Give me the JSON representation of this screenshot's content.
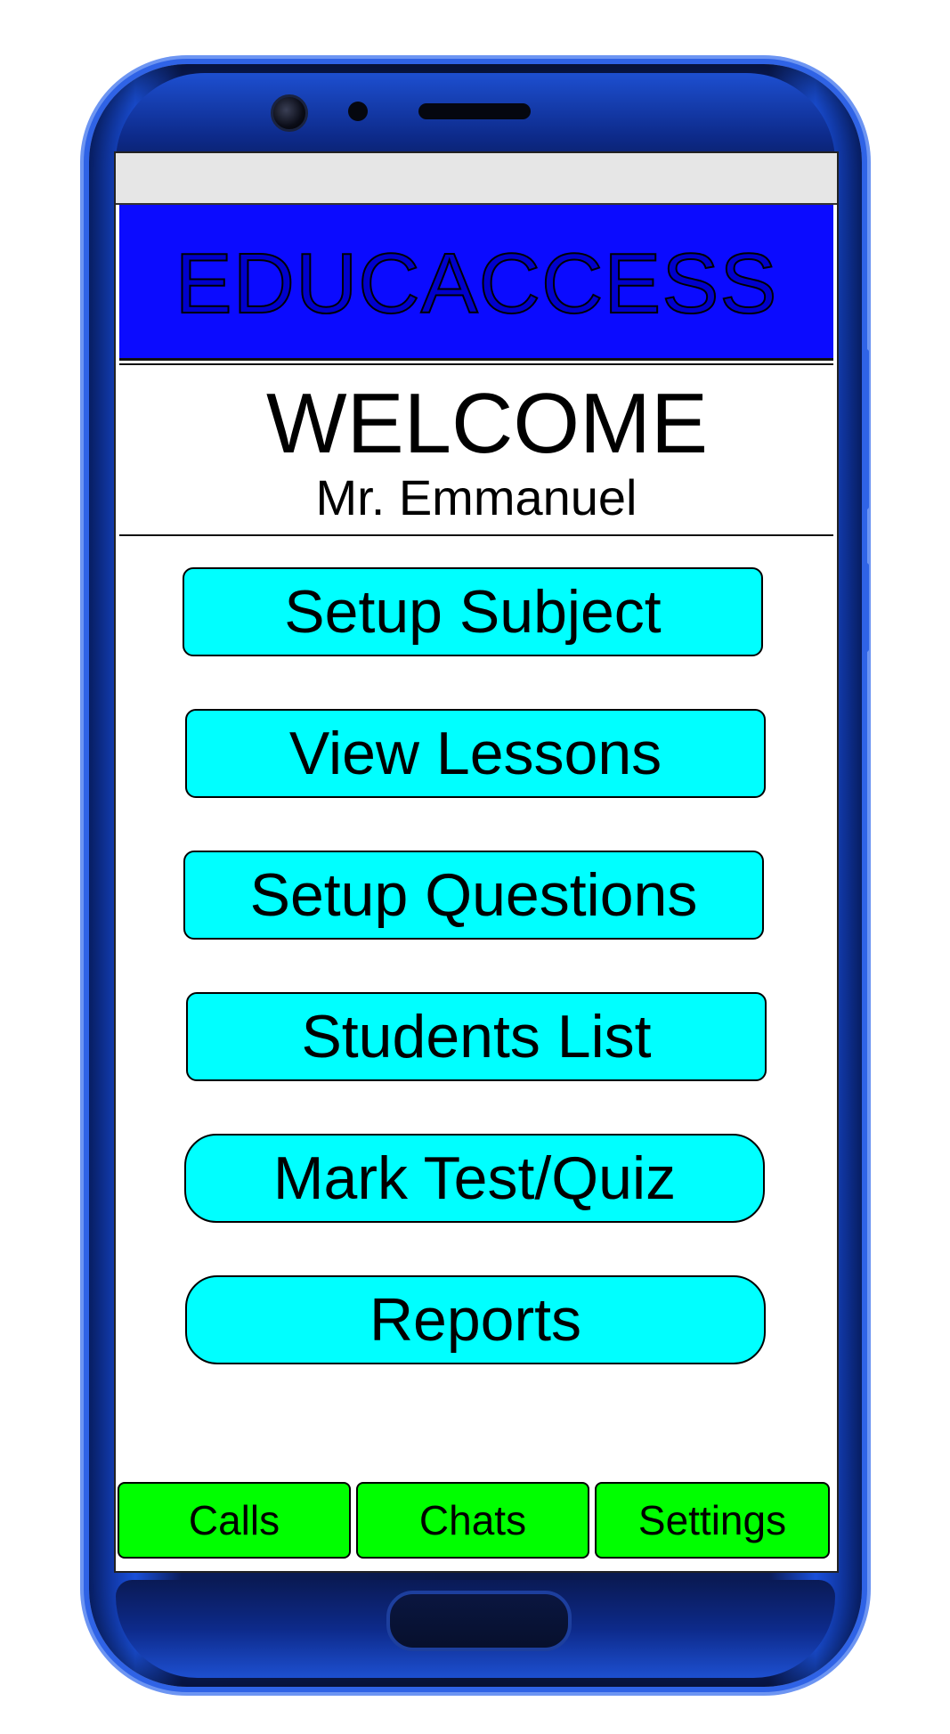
{
  "app": {
    "title": "EDUCACCESS"
  },
  "welcome": {
    "title": "WELCOME",
    "name": "Mr. Emmanuel"
  },
  "menu": [
    {
      "label": "Setup Subject"
    },
    {
      "label": "View Lessons"
    },
    {
      "label": "Setup Questions"
    },
    {
      "label": "Students List"
    },
    {
      "label": "Mark Test/Quiz"
    },
    {
      "label": "Reports"
    }
  ],
  "tabs": [
    {
      "label": "Calls"
    },
    {
      "label": "Chats"
    },
    {
      "label": "Settings"
    }
  ],
  "colors": {
    "header": "#0b0bff",
    "menu_button": "#00ffff",
    "tab_button": "#00ff00",
    "phone_frame": "#1a4fd8"
  },
  "icons": [
    "front-camera-icon",
    "sensor-icon",
    "speaker-icon",
    "home-button-icon"
  ]
}
